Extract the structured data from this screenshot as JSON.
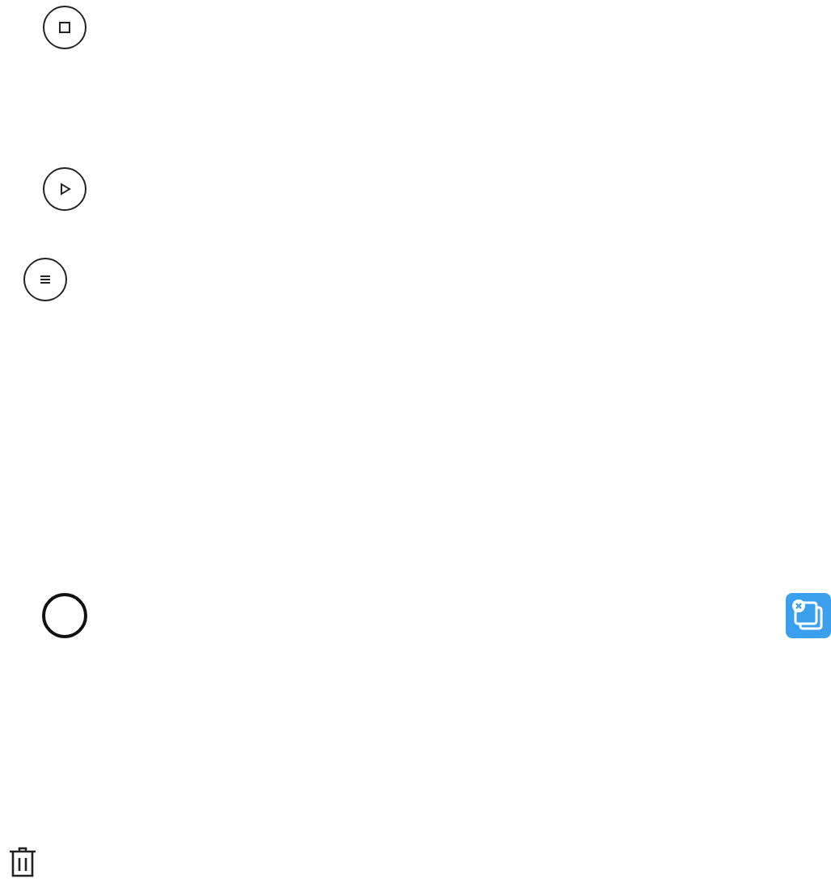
{
  "controls": [
    {
      "kind": "stop"
    },
    {
      "kind": "play"
    },
    {
      "kind": "menu"
    },
    {
      "kind": "record"
    },
    {
      "kind": "app"
    },
    {
      "kind": "delete"
    }
  ]
}
